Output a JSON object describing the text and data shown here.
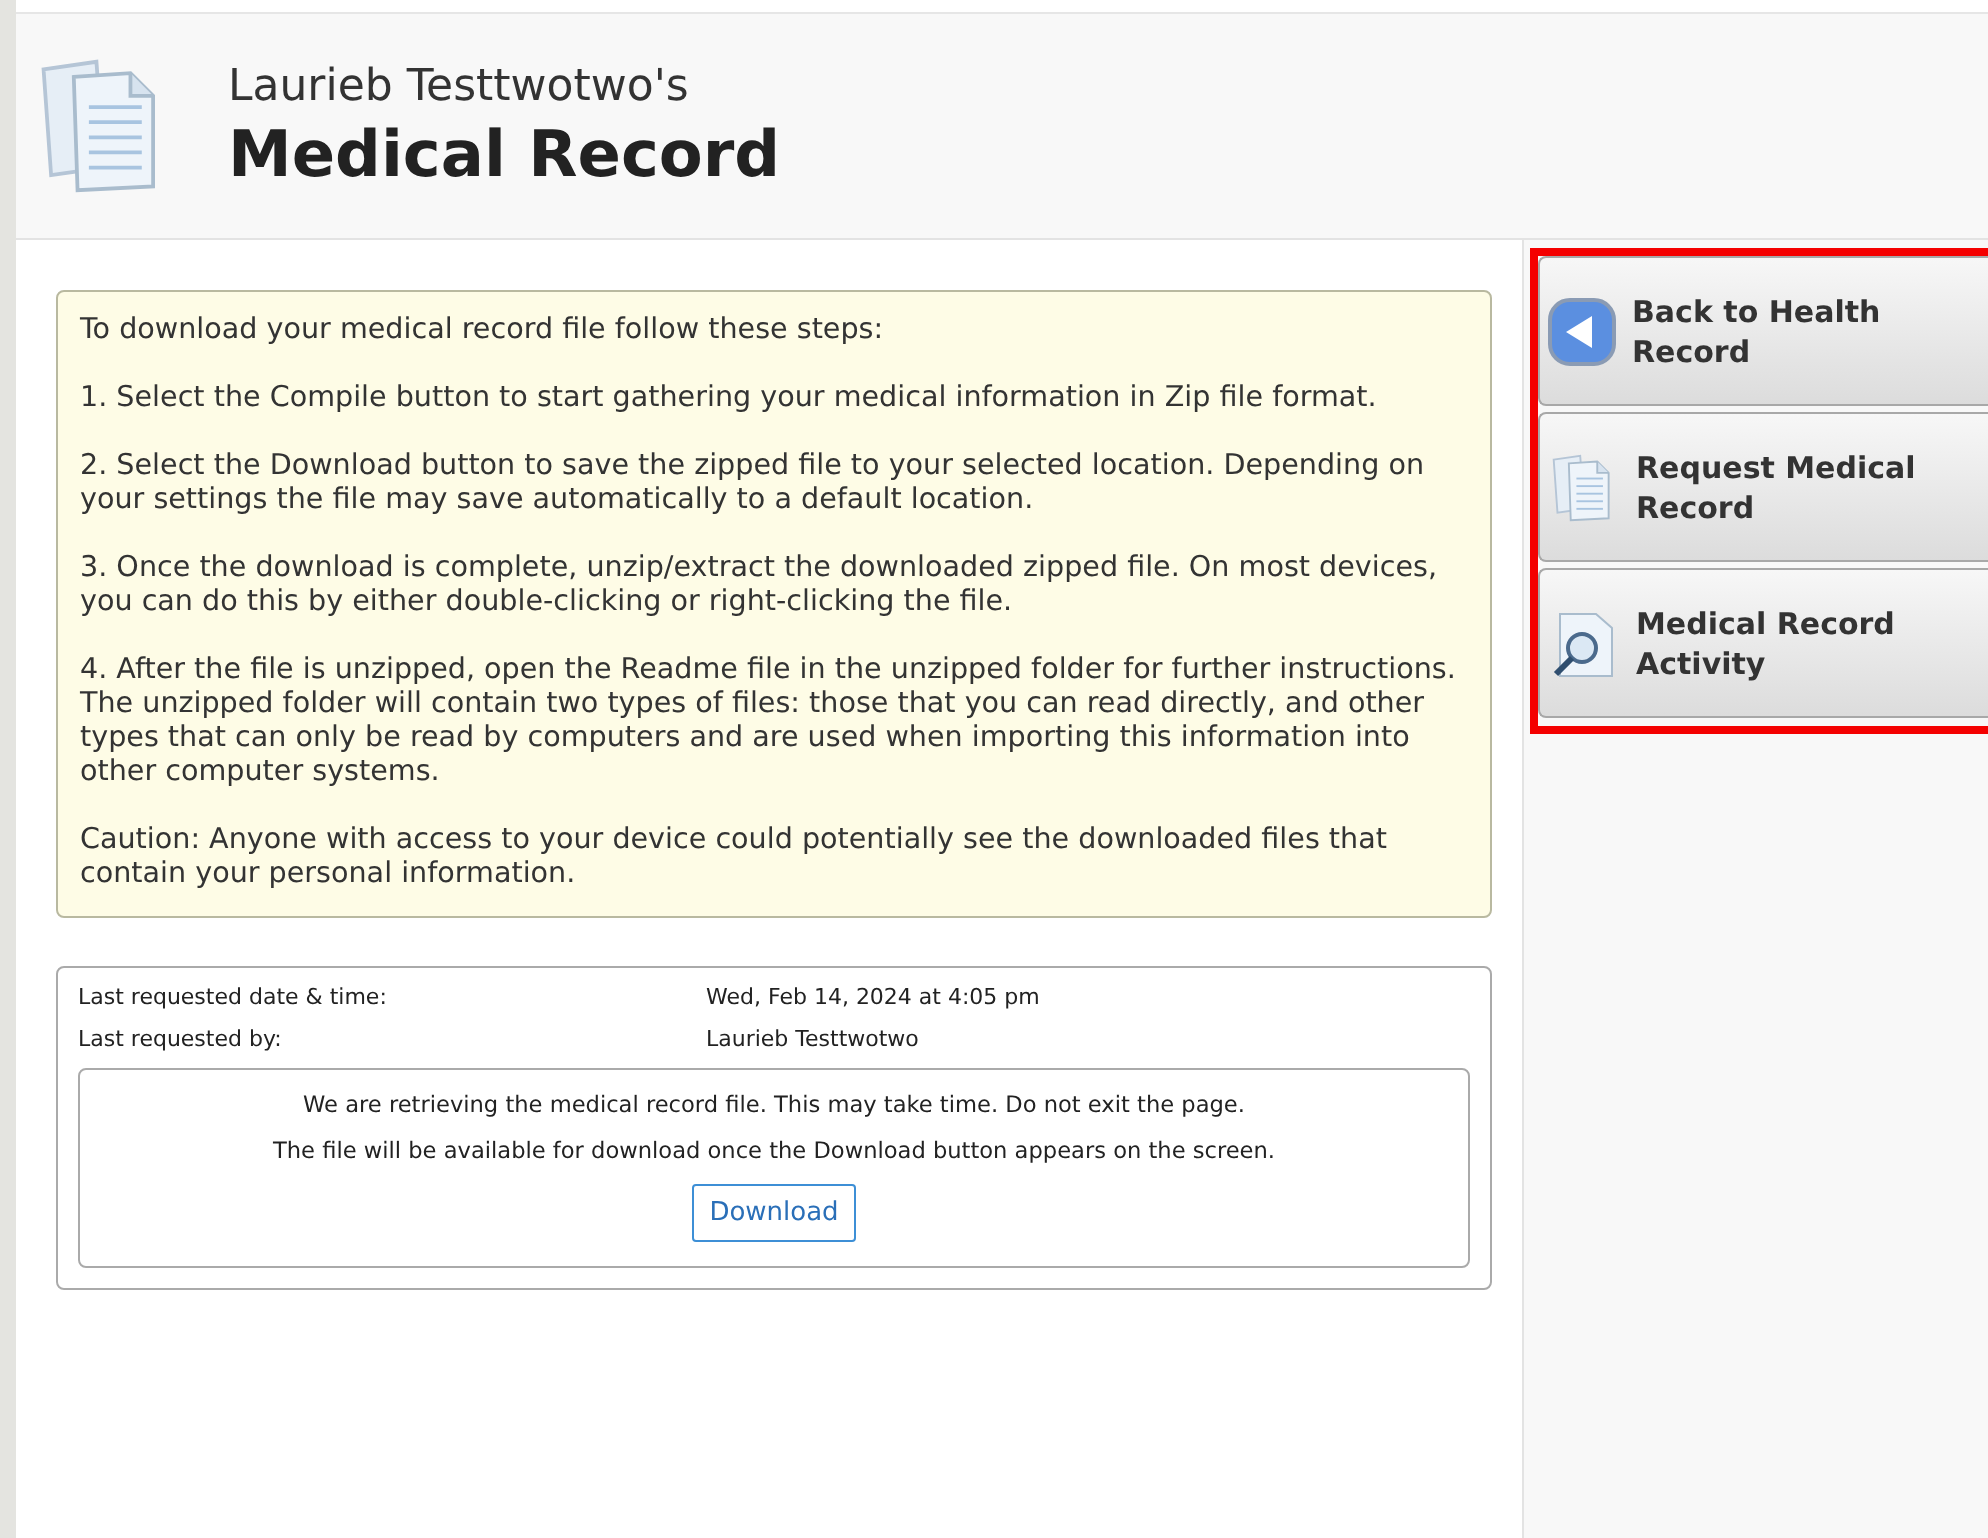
{
  "header": {
    "owner": "Laurieb Testtwotwo's",
    "title": "Medical Record"
  },
  "instructions": [
    "To download your medical record file follow these steps:",
    "1. Select the Compile button to start gathering your medical information in Zip file format.",
    "2. Select the Download button to save the zipped file to your selected location. Depending on your settings the file may save automatically to a default location.",
    "3. Once the download is complete, unzip/extract the downloaded zipped file.  On most devices, you can do this by either double-clicking or right-clicking the file.",
    "4. After the file is unzipped, open the Readme file in the unzipped folder for further instructions. The unzipped folder will contain two types of files: those that you can read directly, and other types that can only be read by computers and are used when importing this information into other computer systems.",
    "Caution: Anyone with access to your device could potentially see the downloaded files that contain your personal information."
  ],
  "request_info": [
    {
      "label": "Last requested date & time:",
      "value": "Wed, Feb 14, 2024 at 4:05 pm"
    },
    {
      "label": "Last requested by:",
      "value": "Laurieb Testtwotwo"
    }
  ],
  "status_messages": [
    "We are retrieving the medical record file. This may take time. Do not exit the page.",
    "The file will be available for download once the Download button appears on the screen."
  ],
  "download_button": "Download",
  "side_buttons": [
    {
      "kind": "back",
      "label": "Back to Health Record"
    },
    {
      "kind": "documents",
      "label": "Request Medical Record"
    },
    {
      "kind": "search",
      "label": "Medical Record Activity"
    }
  ]
}
